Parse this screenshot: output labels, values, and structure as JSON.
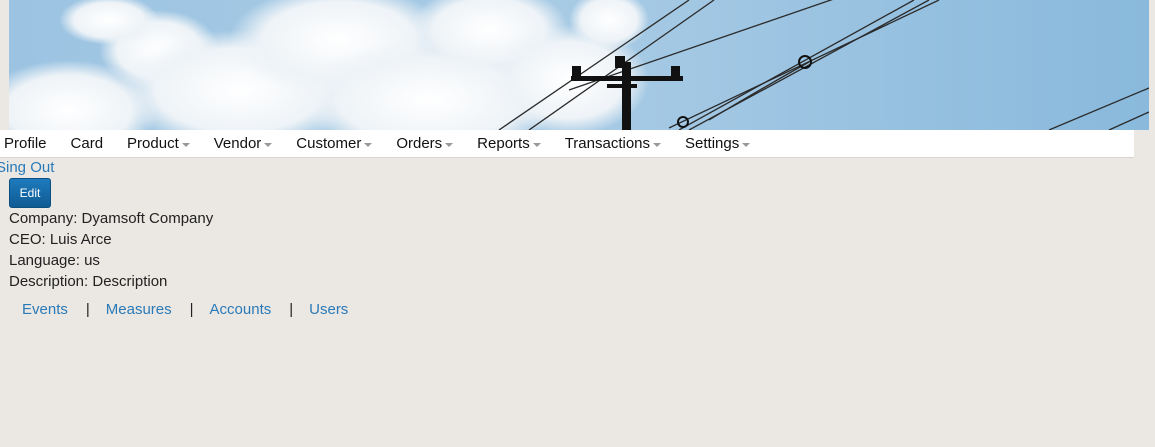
{
  "nav": {
    "items": [
      {
        "label": "Profile",
        "dropdown": false
      },
      {
        "label": "Card",
        "dropdown": false
      },
      {
        "label": "Product",
        "dropdown": true
      },
      {
        "label": "Vendor",
        "dropdown": true
      },
      {
        "label": "Customer",
        "dropdown": true
      },
      {
        "label": "Orders",
        "dropdown": true
      },
      {
        "label": "Reports",
        "dropdown": true
      },
      {
        "label": "Transactions",
        "dropdown": true
      },
      {
        "label": "Settings",
        "dropdown": true
      }
    ]
  },
  "signout_label": "Sing Out",
  "edit_label": "Edit",
  "info": {
    "company": "Company: Dyamsoft Company",
    "ceo": "CEO: Luis Arce",
    "language": "Language: us",
    "description": "Description: Description"
  },
  "links": {
    "events": "Events",
    "measures": "Measures",
    "accounts": "Accounts",
    "users": "Users",
    "separator": "|"
  },
  "colors": {
    "background": "#ebe7e3",
    "link": "#2a7ab8",
    "button": "#1366a3"
  }
}
